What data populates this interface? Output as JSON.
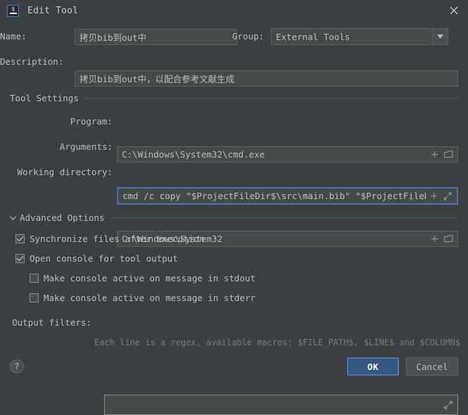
{
  "window": {
    "title": "Edit Tool",
    "app_icon": "intellij-idea-icon",
    "close_icon": "close-icon"
  },
  "form": {
    "name_label": "Name:",
    "name_value": "拷贝bib到out中",
    "group_label": "Group:",
    "group_value": "External Tools",
    "group_options": [
      "External Tools"
    ],
    "description_label": "Description:",
    "description_value": "拷贝bib到out中，以配合参考文献生成"
  },
  "tool_settings": {
    "section_title": "Tool Settings",
    "program_label": "Program:",
    "program_value": "C:\\Windows\\System32\\cmd.exe",
    "arguments_label": "Arguments:",
    "arguments_value": "cmd /c copy \"$ProjectFileDir$\\src\\main.bib\" \"$ProjectFileDir$'",
    "working_directory_label": "Working directory:",
    "working_directory_value": "C:\\Windows\\System32",
    "insert_macro_icon": "plus-icon",
    "browse_icon": "folder-icon",
    "expand_icon": "expand-arrows-icon"
  },
  "advanced_options": {
    "section_title": "Advanced Options",
    "collapse_icon": "chevron-down-icon",
    "checkboxes": [
      {
        "label": "Synchronize files after execution",
        "checked": true,
        "indent": 0
      },
      {
        "label": "Open console for tool output",
        "checked": true,
        "indent": 0
      },
      {
        "label": "Make console active on message in stdout",
        "checked": false,
        "indent": 1
      },
      {
        "label": "Make console active on message in stderr",
        "checked": false,
        "indent": 1
      }
    ],
    "output_filters_label": "Output filters:",
    "output_filters_value": "",
    "output_filters_hint": "Each line is a regex, available macros: $FILE_PATH$, $LINE$ and $COLUMN$",
    "expand_icon": "expand-arrows-icon"
  },
  "footer": {
    "help_label": "?",
    "ok_label": "OK",
    "cancel_label": "Cancel"
  },
  "colors": {
    "background": "#3c3f41",
    "field_background": "#45494a",
    "accent_blue": "#365880",
    "focus_border": "#4b6eaf",
    "text": "#bbbbbb",
    "hint_text": "#787878"
  }
}
